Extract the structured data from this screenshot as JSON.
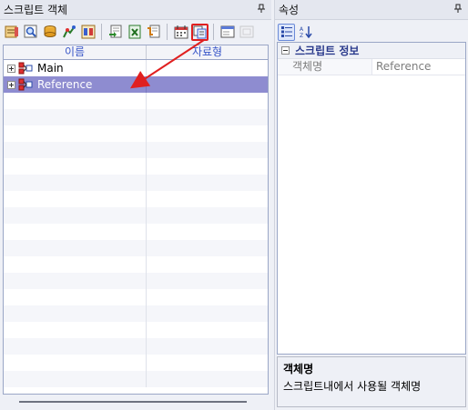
{
  "left_panel": {
    "title": "스크립트 객체",
    "pin": "ᵖ",
    "toolbar": {
      "buttons": [
        "script-edit-icon",
        "search-icon",
        "stack-icon",
        "compile-icon",
        "run-icon",
        "import-icon",
        "export-excel-icon",
        "insert-icon",
        "calendar-icon",
        "copy-object-icon",
        "window-icon",
        "disabled-icon"
      ]
    },
    "grid": {
      "columns": [
        "이름",
        "자료형"
      ],
      "rows": [
        {
          "name": "Main",
          "type": "",
          "selected": false
        },
        {
          "name": "Reference",
          "type": "",
          "selected": true
        }
      ]
    }
  },
  "right_panel": {
    "title": "속성",
    "pin": "ᵖ",
    "category": "스크립트 정보",
    "properties": [
      {
        "name": "객체명",
        "value": "Reference"
      }
    ],
    "description": {
      "title": "객체명",
      "text": "스크립트내에서 사용될 객체명"
    }
  },
  "colors": {
    "selection": "#8e8cd0",
    "header_text": "#3856c8",
    "annotation": "#e02020"
  }
}
